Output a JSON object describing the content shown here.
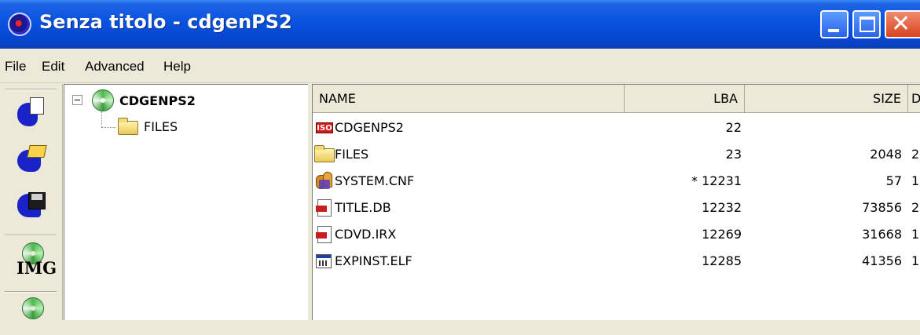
{
  "window": {
    "title": "Senza titolo - cdgenPS2"
  },
  "menu": {
    "items": [
      "File",
      "Edit",
      "Advanced",
      "Help"
    ]
  },
  "toolbar": {
    "buttons": [
      {
        "icon": "new-project-icon"
      },
      {
        "icon": "open-folder-icon"
      },
      {
        "icon": "save-disk-icon"
      },
      {
        "icon": "make-image-icon",
        "label": "IMG"
      },
      {
        "icon": "burn-cd-icon"
      }
    ]
  },
  "tree": {
    "root": {
      "label": "CDGENPS2",
      "expanded": true
    },
    "children": [
      {
        "label": "FILES"
      }
    ]
  },
  "list": {
    "columns": [
      "NAME",
      "LBA",
      "SIZE",
      "D"
    ],
    "rows": [
      {
        "name": "CDGENPS2",
        "lba": "22",
        "size": "",
        "d": "",
        "icon": "iso-icon"
      },
      {
        "name": "FILES",
        "lba": "23",
        "size": "2048",
        "d": "2",
        "icon": "folder-icon"
      },
      {
        "name": "SYSTEM.CNF",
        "lba": "* 12231",
        "size": "57",
        "d": "1",
        "icon": "config-icon"
      },
      {
        "name": "TITLE.DB",
        "lba": "12232",
        "size": "73856",
        "d": "2",
        "icon": "file-icon"
      },
      {
        "name": "CDVD.IRX",
        "lba": "12269",
        "size": "31668",
        "d": "1",
        "icon": "file-icon"
      },
      {
        "name": "EXPINST.ELF",
        "lba": "12285",
        "size": "41356",
        "d": "1",
        "icon": "executable-icon"
      }
    ]
  },
  "colors": {
    "titlebar": "#0a55e0",
    "close_button": "#d9441f",
    "window_bg": "#ece9d8"
  }
}
